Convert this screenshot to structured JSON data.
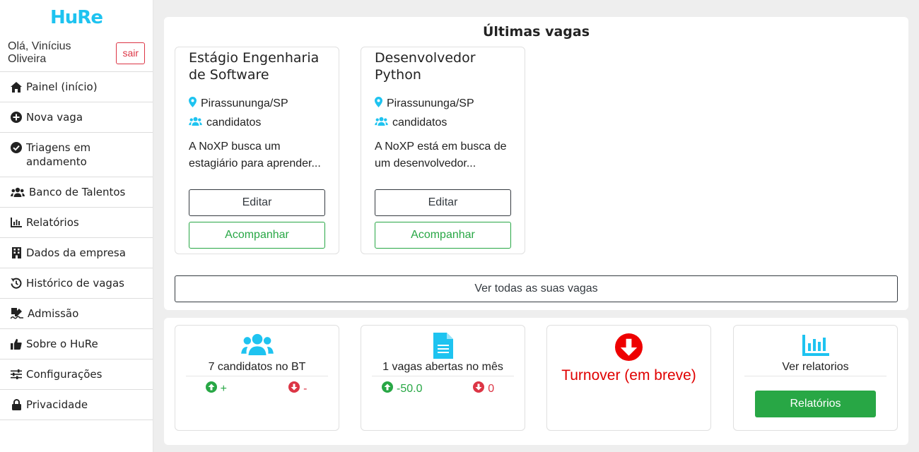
{
  "app": {
    "logo": "HuRe"
  },
  "user": {
    "greeting": "Olá, Vinícius Oliveira",
    "logout_label": "sair"
  },
  "sidebar": {
    "items": [
      {
        "label": "Painel (início)",
        "icon": "home-icon"
      },
      {
        "label": "Nova vaga",
        "icon": "plus-circle-icon"
      },
      {
        "label": "Triagens em andamento",
        "icon": "check-circle-icon"
      },
      {
        "label": "Banco de Talentos",
        "icon": "users-icon"
      },
      {
        "label": "Relatórios",
        "icon": "bar-chart-icon"
      },
      {
        "label": "Dados da empresa",
        "icon": "building-icon"
      },
      {
        "label": "Histórico de vagas",
        "icon": "history-icon"
      },
      {
        "label": "Admissão",
        "icon": "signature-icon"
      },
      {
        "label": "Sobre o HuRe",
        "icon": "thumbs-up-icon"
      },
      {
        "label": "Configurações",
        "icon": "sliders-icon"
      },
      {
        "label": "Privacidade",
        "icon": "lock-icon"
      }
    ]
  },
  "latest_jobs": {
    "title": "Últimas vagas",
    "jobs": [
      {
        "title": "Estágio Engenharia de Software",
        "location": "Pirassununga/SP",
        "candidates": "candidatos",
        "description": "A NoXP busca um estagiário para aprender...",
        "edit_label": "Editar",
        "follow_label": "Acompanhar"
      },
      {
        "title": "Desenvolvedor Python",
        "location": "Pirassununga/SP",
        "candidates": "candidatos",
        "description": "A NoXP está em busca de um desenvolvedor...",
        "edit_label": "Editar",
        "follow_label": "Acompanhar"
      }
    ],
    "view_all_label": "Ver todas as suas vagas"
  },
  "stats": {
    "talent_bank": {
      "label": "7 candidatos no BT",
      "up": "+",
      "down": "-",
      "icon": "users-icon"
    },
    "open_jobs": {
      "label": "1 vagas abertas no mês",
      "up": "-50.0",
      "down": "0",
      "icon": "document-icon"
    },
    "turnover": {
      "label": "Turnover (em breve)",
      "icon": "arrow-down-circle-icon"
    },
    "reports": {
      "label": "Ver relatorios",
      "button_label": "Relatórios",
      "icon": "bar-chart-icon"
    }
  },
  "colors": {
    "brand": "#1ec3f0",
    "green": "#28a745",
    "red": "#dc3545",
    "turnover_red": "#e00000"
  }
}
